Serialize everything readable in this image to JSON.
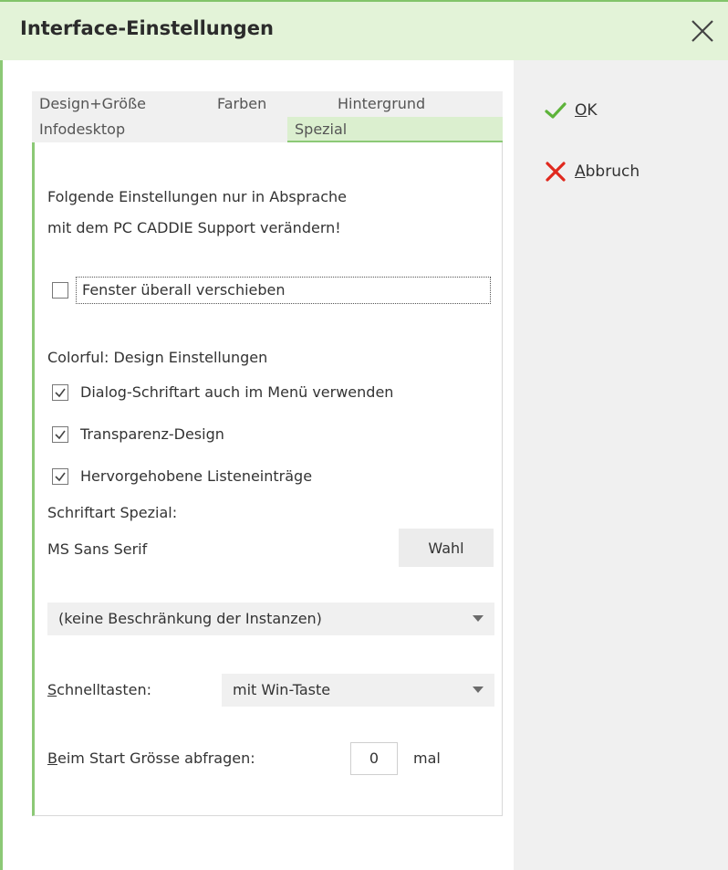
{
  "window": {
    "title": "Interface-Einstellungen"
  },
  "tabs": {
    "row1": [
      "Design+Größe",
      "Farben",
      "Hintergrund"
    ],
    "row2": [
      "Infodesktop",
      "Spezial"
    ],
    "active": "Spezial"
  },
  "actions": {
    "ok_underline": "O",
    "ok_rest": "K",
    "cancel_underline": "A",
    "cancel_rest": "bbruch"
  },
  "content": {
    "warning_line1": "Folgende Einstellungen nur in Absprache",
    "warning_line2": "mit dem PC CADDIE Support verändern!",
    "move_windows_label": "Fenster überall verschieben",
    "move_windows_checked": false,
    "colorful_heading": "Colorful: Design Einstellungen",
    "checkboxes": [
      {
        "label": "Dialog-Schriftart auch im Menü verwenden",
        "checked": true
      },
      {
        "label": "Transparenz-Design",
        "checked": true
      },
      {
        "label": "Hervorgehobene Listeneinträge",
        "checked": true
      }
    ],
    "font_special_label": "Schriftart Spezial:",
    "font_special_value": "MS Sans Serif",
    "choose_button": "Wahl",
    "instances_select": "(keine Beschränkung der Instanzen)",
    "hotkeys_underline": "S",
    "hotkeys_rest": "chnelltasten:",
    "hotkeys_select": "mit Win-Taste",
    "startsize_underline": "B",
    "startsize_rest": "eim Start Grösse abfragen:",
    "startsize_value": "0",
    "startsize_unit": "mal"
  },
  "colors": {
    "accent": "#8cc976",
    "title_bg": "#e3f3d8",
    "ok_icon": "#5db33a",
    "cancel_icon": "#e0281d"
  },
  "icons": {
    "close": "close-icon",
    "ok": "check-icon",
    "cancel": "x-icon",
    "dropdown": "chevron-down-icon"
  }
}
